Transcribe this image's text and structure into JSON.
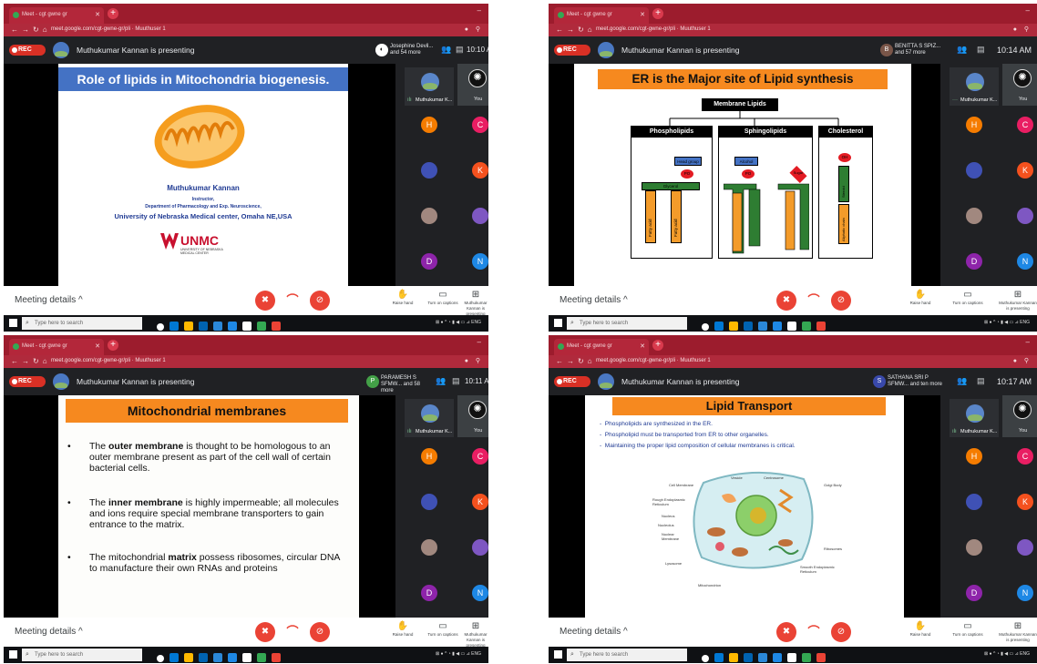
{
  "colors": {
    "chrome_red": "#9c1c2d",
    "meet_dark": "#202124",
    "slide_orange": "#f6891f",
    "slide_blue": "#4472c4",
    "unmc_red": "#c8102e",
    "end_call_red": "#ea4335",
    "diagram_green": "#2e7d32",
    "tail_orange": "#f39b2a"
  },
  "common": {
    "tab_label": "Meet - cgt gwne gr",
    "url": "meet.google.com/cgt-gwne-gr/pli · Muuthuser 1",
    "rec": "REC",
    "meeting_details": "Meeting details",
    "raise_hand": "Raise hand",
    "captions": "Turn on captions",
    "presenting_tool": "Muthukumar Kannan is presenting",
    "search": "Type here to search",
    "you_label": "You",
    "presenter_tile": "Muthukumar K...",
    "participants": [
      "H",
      "C",
      "",
      "K",
      "",
      "",
      "D",
      "N"
    ],
    "icons": [
      "new-tab-icon",
      "back-icon",
      "forward-icon",
      "reload-icon",
      "home-icon",
      "lock-icon",
      "people-icon",
      "chat-icon",
      "mic-off-icon",
      "end-call-icon",
      "camera-off-icon",
      "raise-hand-icon",
      "captions-icon",
      "present-icon",
      "windows-icon",
      "search-icon"
    ]
  },
  "panels": [
    {
      "presenting": "Muthukumar Kannan is presenting",
      "viewers": "Josephine Devil... and 54 more",
      "people_count": "59",
      "time": "10:10 AM",
      "slide": {
        "title": "Role of lipids in Mitochondria biogenesis.",
        "name": "Muthukumar Kannan",
        "role": "Instructor,",
        "dept": "Department of Pharmacology and Exp. Neuroscience,",
        "univ": "University of Nebraska Medical center, Omaha NE,USA",
        "logo": "UNMC",
        "logo_sub": "UNIVERSITY OF NEBRASKA MEDICAL CENTER"
      }
    },
    {
      "presenting": "Muthukumar Kannan is presenting",
      "viewers": "BENITTA S SPIZ... and 57 more",
      "people_count": "60",
      "time": "10:14 AM",
      "slide": {
        "title": "ER is the Major site of Lipid synthesis",
        "root": "Membrane Lipids",
        "col1": "Phospholipids",
        "col2": "Sphingolipids",
        "col3": "Cholesterol",
        "head_group": "Head group",
        "alcohol": "Alcohol",
        "po": "PO",
        "sugar": "Sugar",
        "glycerol": "Glycerol",
        "sphingosine": "Sphingosine",
        "fatty_acid": "Fatty acid",
        "oh": "OH",
        "steroid": "Steroid",
        "aliphatic": "Aliphatic chain"
      }
    },
    {
      "presenting": "Muthukumar Kannan is presenting",
      "viewers": "PARAMESH S SFMW... and 58 more",
      "people_count": "61",
      "time": "10:11 AM",
      "slide": {
        "title": "Mitochondrial membranes",
        "b1_pre": "The ",
        "b1_bold": "outer membrane",
        "b1_post": " is thought to be homologous to an outer membrane present as part of the cell wall of certain bacterial cells.",
        "b2_pre": "The ",
        "b2_bold": "inner membrane",
        "b2_post": " is highly impermeable; all molecules and ions require special membrane transporters to gain entrance to the matrix.",
        "b3_pre": "The mitochondrial ",
        "b3_bold": "matrix",
        "b3_post": " possess ribosomes, circular DNA to manufacture their own RNAs and proteins"
      }
    },
    {
      "presenting": "Muthukumar Kannan is presenting",
      "viewers": "SATHANA SRI P SFMW... and ten more",
      "people_count": "61",
      "time": "10:17 AM",
      "slide": {
        "title": "Lipid Transport",
        "bullets": [
          "Phospholipids are synthesized in the ER.",
          "Phospholipid must be transported from ER to other organelles.",
          "Maintaining the proper lipid composition of cellular membranes is critical."
        ],
        "labels": [
          "Cell Membrane",
          "Vesicle",
          "Centrosome",
          "Golgi Body",
          "Rough Endoplasmic Reticulum",
          "Nucleus",
          "Nucleolus",
          "Nuclear Membrane",
          "Ribosomes",
          "Lysosome",
          "Smooth Endoplasmic Reticulum",
          "Mitochondrion"
        ]
      }
    }
  ]
}
